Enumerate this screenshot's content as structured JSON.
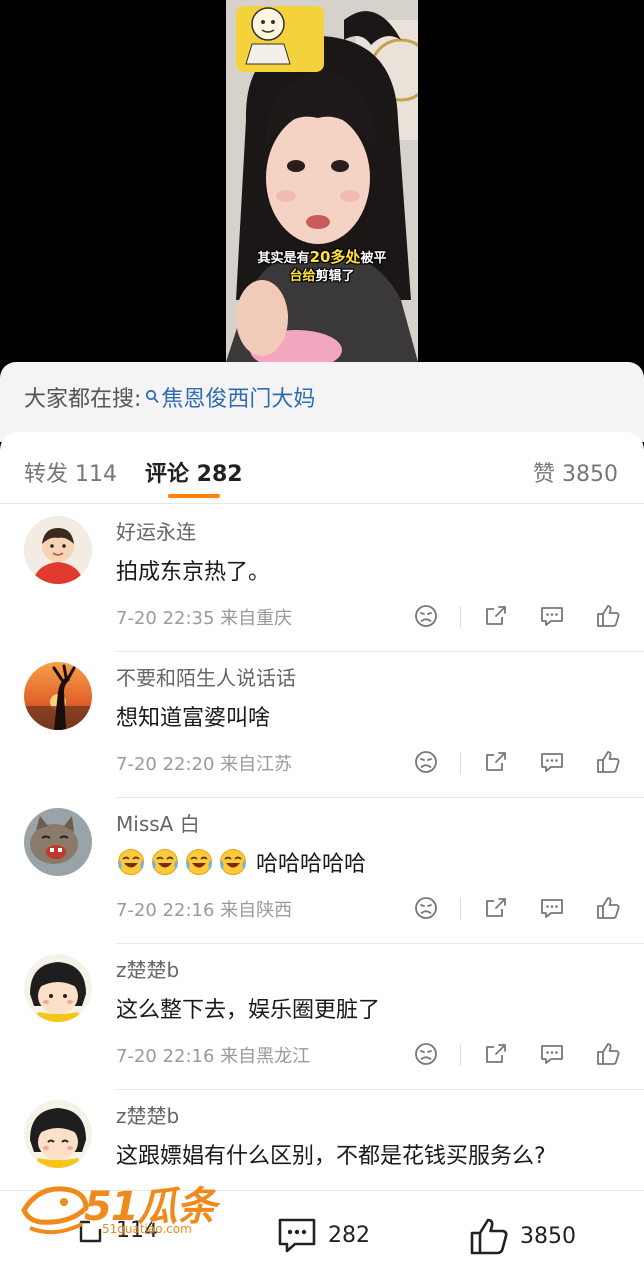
{
  "video": {
    "caption_line1_a": "其实是有",
    "caption_line1_b": "20多处",
    "caption_line1_c": "被平",
    "caption_line2_a": "台给",
    "caption_line2_b": "剪辑",
    "caption_line2_c": "了"
  },
  "search": {
    "prefix": "大家都在搜:",
    "hot_term": "焦恩俊西门大妈"
  },
  "tabs": {
    "repost": "转发 114",
    "comment": "评论 282",
    "like": "赞 3850"
  },
  "comments": [
    {
      "name": "好运永连",
      "text": "拍成东京热了。",
      "meta": "7-20 22:35 来自重庆"
    },
    {
      "name": "不要和陌生人说话话",
      "text": "想知道富婆叫啥",
      "meta": "7-20 22:20 来自江苏"
    },
    {
      "name": "MissA 白",
      "emoji": [
        "laughing-crying-icon",
        "laughing-crying-icon",
        "laughing-crying-icon",
        "laughing-crying-icon"
      ],
      "text": "哈哈哈哈哈",
      "meta": "7-20 22:16 来自陕西"
    },
    {
      "name": "z楚楚b",
      "text": "这么整下去，娱乐圈更脏了",
      "meta": "7-20 22:16 来自黑龙江"
    },
    {
      "name": "z楚楚b",
      "text": "这跟嫖娼有什么区别，不都是花钱买服务么?",
      "meta": ""
    }
  ],
  "bottom_bar": {
    "repost_count": "114",
    "comment_count": "282",
    "like_count": "3850"
  },
  "watermark": {
    "text": "51瓜条",
    "sub": "51guatiao.com"
  },
  "colors": {
    "accent": "#ff8200",
    "link": "#2e6db4",
    "watermark": "#f08a1c"
  }
}
